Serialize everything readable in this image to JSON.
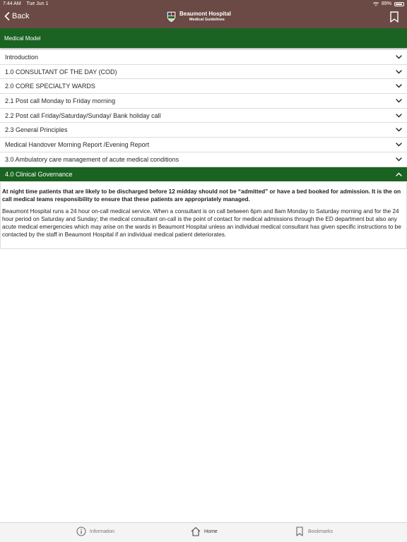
{
  "status_bar": {
    "time": "7:44 AM",
    "date": "Tue Jun 1",
    "battery": "89%"
  },
  "nav": {
    "back_label": "Back",
    "title": "Beaumont Hospital",
    "subtitle": "Medical Guidelines"
  },
  "section": {
    "title": "Medical Model"
  },
  "accordion": {
    "items": [
      {
        "label": "Introduction"
      },
      {
        "label": "1.0 CONSULTANT OF THE DAY (COD)"
      },
      {
        "label": "2.0 CORE SPECIALTY WARDS"
      },
      {
        "label": "2.1 Post call Monday to Friday morning"
      },
      {
        "label": "2.2 Post call Friday/Saturday/Sunday/ Bank holiday call"
      },
      {
        "label": "2.3 General Principles"
      },
      {
        "label": "Medical Handover Morning Report /Evening Report"
      },
      {
        "label": "3.0 Ambulatory care management of acute medical conditions"
      },
      {
        "label": "4.0 Clinical Governance",
        "expanded": true
      }
    ]
  },
  "content": {
    "bold_text": "At night time patients that are likely to be discharged before 12 midday should not be “admitted” or have a bed booked for admission. It is the on call medical teams responsibility to ensure that these patients are appropriately managed.",
    "body_text": "Beaumont Hospital runs a 24 hour on-call medical service. When a consultant is on call between 6pm and 8am Monday to Saturday morning and for the 24 hour period on Saturday and Sunday; the medical consultant on-call is the point of contact for medical admissions through the ED department but also any acute medical emergencies which may arise on the wards in Beaumont Hospital unless an individual medical consultant has given specific instructions to be contacted by the staff in Beaumont Hospital if an individual medical patient deteriorates."
  },
  "tabs": {
    "information": "Information",
    "home": "Home",
    "bookmarks": "Bookmarks"
  },
  "colors": {
    "header": "#6b4a45",
    "accent_green": "#1a6322"
  },
  "icons": [
    "chevron-left-icon",
    "hospital-crest-icon",
    "bookmark-icon",
    "wifi-icon",
    "battery-icon",
    "chevron-down-icon",
    "chevron-up-icon",
    "info-icon",
    "home-icon"
  ]
}
